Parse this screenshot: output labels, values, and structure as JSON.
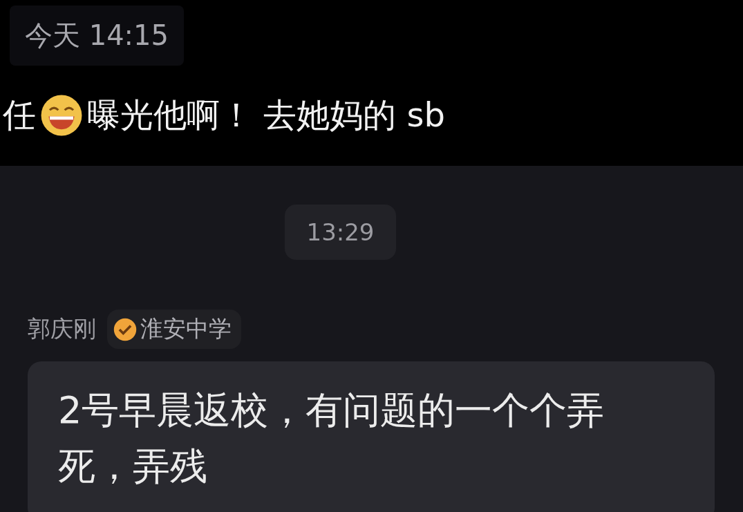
{
  "top_chat": {
    "timestamp": "今天 14:15",
    "message_parts": [
      "任",
      "曝光他啊！ 去她妈的 sb"
    ]
  },
  "chat": {
    "timestamp": "13:29",
    "sender": {
      "name": "郭庆刚",
      "badge": "淮安中学"
    },
    "messages": [
      {
        "text": "2号早晨返校，有问题的一个个弄死，弄残"
      }
    ]
  }
}
